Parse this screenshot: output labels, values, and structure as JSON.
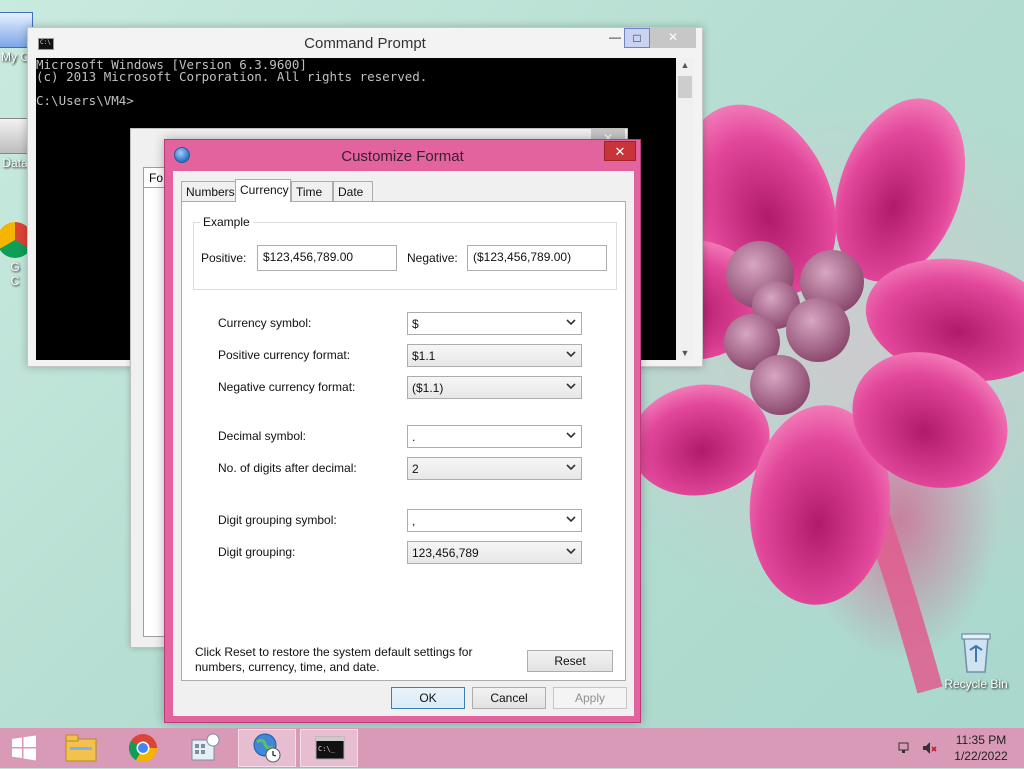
{
  "desktop": {
    "icons": [
      {
        "label": "My C"
      },
      {
        "label": "Data"
      },
      {
        "label": "G\nC"
      }
    ],
    "recycle_bin": "Recycle Bin"
  },
  "cmd_window": {
    "title": "Command Prompt",
    "icon_text": "C:\\",
    "lines": [
      "Microsoft Windows [Version 6.3.9600]",
      "(c) 2013 Microsoft Corporation. All rights reserved.",
      "",
      "C:\\Users\\VM4>"
    ]
  },
  "region_window": {
    "tab_fragment": "Fo"
  },
  "dialog": {
    "title": "Customize Format",
    "close_label": "✕",
    "tabs": [
      {
        "label": "Numbers",
        "active": false
      },
      {
        "label": "Currency",
        "active": true
      },
      {
        "label": "Time",
        "active": false
      },
      {
        "label": "Date",
        "active": false
      }
    ],
    "example": {
      "legend": "Example",
      "positive_label": "Positive:",
      "positive_value": "$123,456,789.00",
      "negative_label": "Negative:",
      "negative_value": "($123,456,789.00)"
    },
    "settings": [
      {
        "label": "Currency symbol:",
        "value": "$",
        "style": "white"
      },
      {
        "label": "Positive currency format:",
        "value": "$1.1",
        "style": "gray"
      },
      {
        "label": "Negative currency format:",
        "value": "($1.1)",
        "style": "gray"
      },
      {
        "label": "Decimal symbol:",
        "value": ".",
        "style": "white"
      },
      {
        "label": "No. of digits after decimal:",
        "value": "2",
        "style": "gray"
      },
      {
        "label": "Digit grouping symbol:",
        "value": ",",
        "style": "white"
      },
      {
        "label": "Digit grouping:",
        "value": "123,456,789",
        "style": "gray"
      }
    ],
    "reset_note": "Click Reset to restore the system default settings for numbers, currency, time, and date.",
    "reset_label": "Reset",
    "ok_label": "OK",
    "cancel_label": "Cancel",
    "apply_label": "Apply"
  },
  "taskbar": {
    "items": [
      "start-icon",
      "file-explorer-icon",
      "chrome-icon",
      "control-panel-icon",
      "region-icon",
      "command-prompt-icon"
    ],
    "time": "11:35 PM",
    "date": "1/22/2022"
  }
}
